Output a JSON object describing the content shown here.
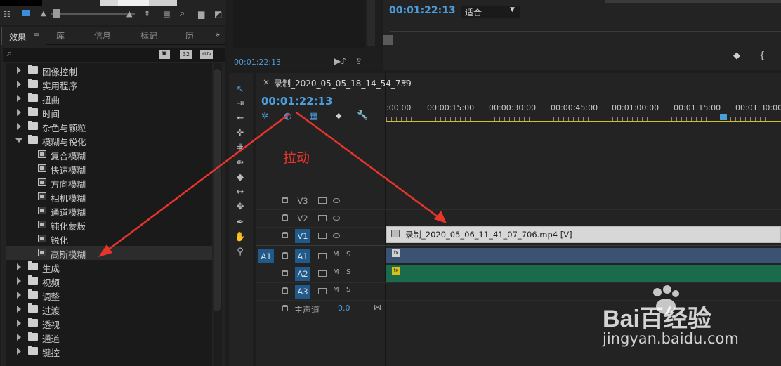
{
  "source_monitor": {
    "timecode": "00:01:22:13"
  },
  "program_monitor": {
    "timecode": "00:01:22:13",
    "zoom_value": "适合"
  },
  "effects_panel": {
    "tabs": [
      "效果",
      "库",
      "信息",
      "标记",
      "历"
    ],
    "tab_menu_glyph": "≡",
    "badges": [
      "32",
      "YUV"
    ],
    "items": [
      {
        "label": "图像控制",
        "type": "folder",
        "expanded": false
      },
      {
        "label": "实用程序",
        "type": "folder",
        "expanded": false
      },
      {
        "label": "扭曲",
        "type": "folder",
        "expanded": false
      },
      {
        "label": "时间",
        "type": "folder",
        "expanded": false
      },
      {
        "label": "杂色与颗粒",
        "type": "folder",
        "expanded": false
      },
      {
        "label": "模糊与锐化",
        "type": "folder",
        "expanded": true
      },
      {
        "label": "复合模糊",
        "type": "effect"
      },
      {
        "label": "快速模糊",
        "type": "effect"
      },
      {
        "label": "方向模糊",
        "type": "effect"
      },
      {
        "label": "相机模糊",
        "type": "effect"
      },
      {
        "label": "通道模糊",
        "type": "effect"
      },
      {
        "label": "钝化蒙版",
        "type": "effect"
      },
      {
        "label": "锐化",
        "type": "effect"
      },
      {
        "label": "高斯模糊",
        "type": "effect",
        "selected": true
      },
      {
        "label": "生成",
        "type": "folder",
        "expanded": false
      },
      {
        "label": "视频",
        "type": "folder",
        "expanded": false
      },
      {
        "label": "调整",
        "type": "folder",
        "expanded": false
      },
      {
        "label": "过渡",
        "type": "folder",
        "expanded": false
      },
      {
        "label": "透视",
        "type": "folder",
        "expanded": false
      },
      {
        "label": "通道",
        "type": "folder",
        "expanded": false
      },
      {
        "label": "键控",
        "type": "folder",
        "expanded": false
      }
    ]
  },
  "timeline": {
    "close_glyph": "×",
    "sequence_name": "录制_2020_05_05_18_14_54_739",
    "menu_glyph": "≡",
    "timecode": "00:01:22:13",
    "ruler_labels": [
      ":00:00",
      "00:00:15:00",
      "00:00:30:00",
      "00:00:45:00",
      "00:01:00:00",
      "00:01:15:00",
      "00:01:30:00"
    ],
    "annotation": "拉动",
    "tracks": [
      {
        "name": "V3",
        "kind": "video"
      },
      {
        "name": "V2",
        "kind": "video"
      },
      {
        "name": "V1",
        "kind": "video",
        "targeted": true
      },
      {
        "name": "A1",
        "kind": "audio",
        "source": "A1",
        "targeted": true
      },
      {
        "name": "A2",
        "kind": "audio",
        "targeted": true
      },
      {
        "name": "A3",
        "kind": "audio",
        "targeted": true
      }
    ],
    "mute_label": "M",
    "solo_label": "S",
    "master": {
      "label": "主声道",
      "value": "0.0"
    },
    "clip_v1_label": "录制_2020_05_06_11_41_07_706.mp4 [V]",
    "fx_badge": "fx"
  },
  "colors": {
    "accent_blue": "#4c9ddc",
    "arrow_red": "#e8342a",
    "audio_clip_a1": "#3b5273",
    "audio_clip_a2": "#1a6b4b"
  },
  "watermark": {
    "brand": "Bai百经验",
    "url": "jingyan.baidu.com"
  }
}
